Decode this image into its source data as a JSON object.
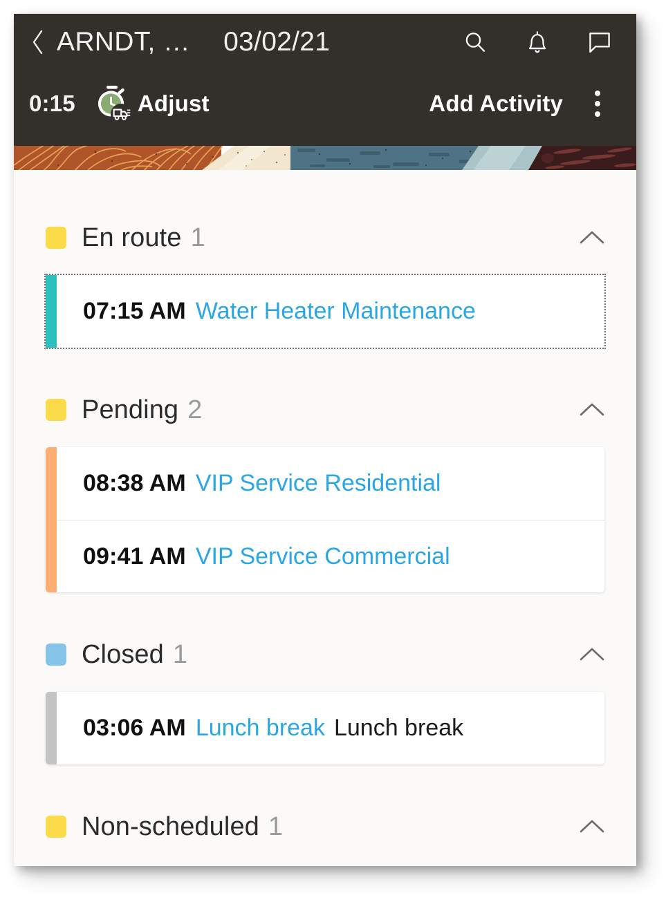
{
  "appbar": {
    "back_icon": "chevron-left-icon",
    "customer_name": "ARNDT, …",
    "date": "03/02/21",
    "search_icon": "search-icon",
    "notification_icon": "bell-icon",
    "chat_icon": "chat-bubble-icon"
  },
  "toolbar": {
    "timer_value": "0:15",
    "timer_icon": "stopwatch-truck-icon",
    "adjust_label": "Adjust",
    "add_activity_label": "Add Activity",
    "overflow_icon": "kebab-menu-icon"
  },
  "colors": {
    "appbar_bg": "#332f2b",
    "content_bg": "#fbfaf8",
    "link": "#2ba6e4",
    "swatch_yellow": "#fbdb4a",
    "swatch_blue": "#85c3e8",
    "accent_teal": "#2bbfbf",
    "accent_orange": "#fcae73",
    "accent_gray": "#c4c4c4",
    "timer_icon_green": "#8aab72"
  },
  "groups": [
    {
      "label": "En route",
      "count": "1",
      "swatch_color": "#fbdb4a",
      "accent_color": "#2bbfbf",
      "collapse_icon": "chevron-up-icon",
      "focused": true,
      "rows": [
        {
          "time": "07:15 AM",
          "link": "Water Heater Maintenance",
          "sub": ""
        }
      ]
    },
    {
      "label": "Pending",
      "count": "2",
      "swatch_color": "#fbdb4a",
      "accent_color": "#fcae73",
      "collapse_icon": "chevron-up-icon",
      "focused": false,
      "rows": [
        {
          "time": "08:38 AM",
          "link": "VIP Service Residential",
          "sub": ""
        },
        {
          "time": "09:41 AM",
          "link": "VIP Service Commercial",
          "sub": ""
        }
      ]
    },
    {
      "label": "Closed",
      "count": "1",
      "swatch_color": "#85c3e8",
      "accent_color": "#c4c4c4",
      "collapse_icon": "chevron-up-icon",
      "focused": false,
      "rows": [
        {
          "time": "03:06 AM",
          "link": "Lunch break",
          "sub": "Lunch break"
        }
      ]
    },
    {
      "label": "Non-scheduled",
      "count": "1",
      "swatch_color": "#fbdb4a",
      "accent_color": "#fbdb4a",
      "collapse_icon": "chevron-up-icon",
      "focused": false,
      "rows": []
    }
  ]
}
